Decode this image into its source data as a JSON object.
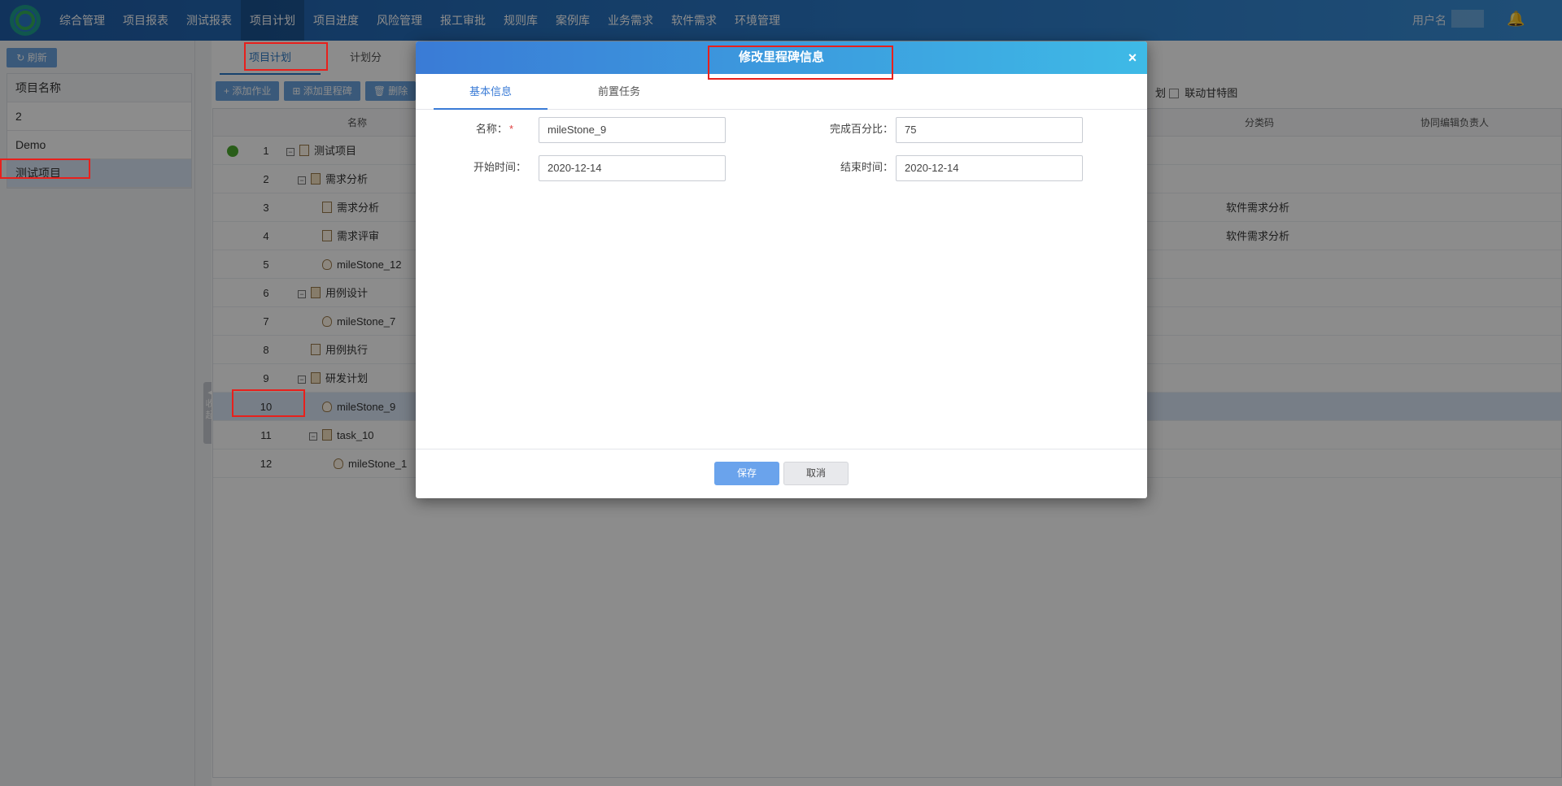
{
  "nav": {
    "items": [
      "综合管理",
      "项目报表",
      "测试报表",
      "项目计划",
      "项目进度",
      "风险管理",
      "报工审批",
      "规则库",
      "案例库",
      "业务需求",
      "软件需求",
      "环境管理"
    ],
    "active_index": 3,
    "user_label": "用户名",
    "bell_icon": "bell-icon"
  },
  "left": {
    "refresh_label": "刷新",
    "projects": [
      {
        "label": "项目名称"
      },
      {
        "label": "2"
      },
      {
        "label": "Demo"
      },
      {
        "label": "测试项目"
      }
    ],
    "collapse_label": "收起"
  },
  "main": {
    "tabs": [
      "项目计划",
      "计划分"
    ],
    "toolbar": [
      "+ 添加作业",
      "⊞ 添加里程碑",
      "🗑 删除"
    ],
    "gantt_prefix": "划",
    "gantt_label": "联动甘特图",
    "columns": {
      "name": "名称",
      "category": "分类码",
      "editor": "协同编辑负责人"
    },
    "rows": [
      {
        "num": "1",
        "name": "测试项目",
        "indent": 0,
        "expander": true,
        "type": "project",
        "category": ""
      },
      {
        "num": "2",
        "name": "需求分析",
        "indent": 1,
        "expander": true,
        "type": "folder",
        "category": ""
      },
      {
        "num": "3",
        "name": "需求分析",
        "indent": 2,
        "expander": false,
        "type": "task",
        "category": "软件需求分析"
      },
      {
        "num": "4",
        "name": "需求评审",
        "indent": 2,
        "expander": false,
        "type": "task",
        "category": "软件需求分析"
      },
      {
        "num": "5",
        "name": "mileStone_12",
        "indent": 2,
        "expander": false,
        "type": "milestone",
        "category": ""
      },
      {
        "num": "6",
        "name": "用例设计",
        "indent": 1,
        "expander": true,
        "type": "folder",
        "category": ""
      },
      {
        "num": "7",
        "name": "mileStone_7",
        "indent": 2,
        "expander": false,
        "type": "milestone",
        "category": ""
      },
      {
        "num": "8",
        "name": "用例执行",
        "indent": 1,
        "expander": false,
        "type": "task",
        "category": ""
      },
      {
        "num": "9",
        "name": "研发计划",
        "indent": 1,
        "expander": true,
        "type": "folder",
        "category": ""
      },
      {
        "num": "10",
        "name": "mileStone_9",
        "indent": 2,
        "expander": false,
        "type": "milestone",
        "category": ""
      },
      {
        "num": "11",
        "name": "task_10",
        "indent": 2,
        "expander": true,
        "type": "folder",
        "category": ""
      },
      {
        "num": "12",
        "name": "mileStone_1",
        "indent": 3,
        "expander": false,
        "type": "milestone",
        "category": ""
      }
    ]
  },
  "dialog": {
    "title": "修改里程碑信息",
    "close": "×",
    "tabs": [
      "基本信息",
      "前置任务"
    ],
    "fields": {
      "name_label": "名称：",
      "name_required": "*",
      "name_value": "mileStone_9",
      "percent_label": "完成百分比：",
      "percent_value": "75",
      "start_label": "开始时间：",
      "start_value": "2020-12-14",
      "end_label": "结束时间：",
      "end_value": "2020-12-14"
    },
    "save": "保存",
    "cancel": "取消"
  },
  "colors": {
    "accent": "#2a78c6",
    "annotation": "#e8201c",
    "status_ok": "#4caa2e"
  }
}
